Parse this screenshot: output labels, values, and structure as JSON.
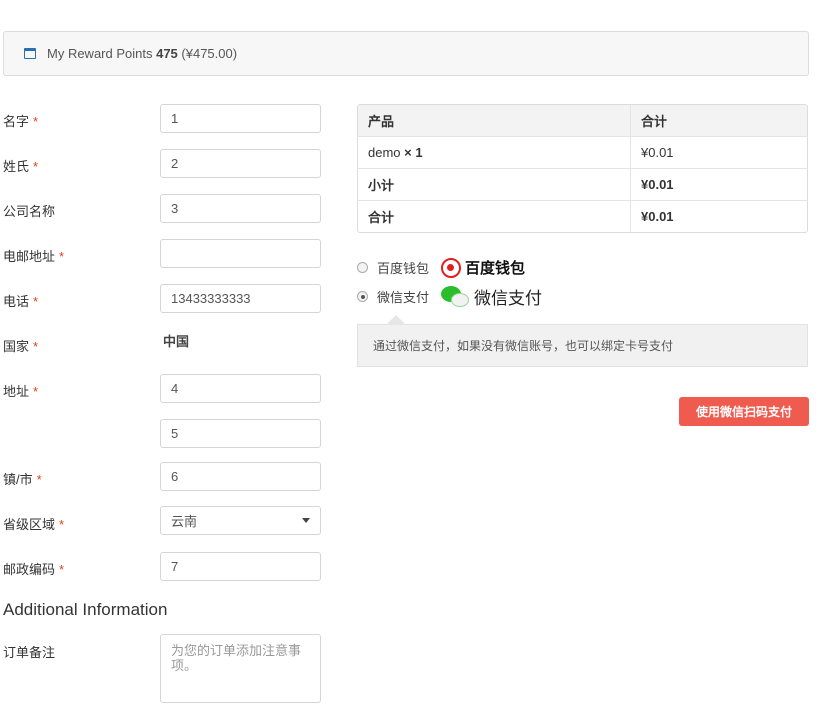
{
  "notice": {
    "prefix": "My Reward Points ",
    "points": "475",
    "suffix": " (¥475.00)"
  },
  "form": {
    "first_name": {
      "label": "名字",
      "required": "*",
      "value": "1"
    },
    "last_name": {
      "label": "姓氏",
      "required": "*",
      "value": "2"
    },
    "company": {
      "label": "公司名称",
      "value": "3"
    },
    "email": {
      "label": "电邮地址",
      "required": "*",
      "value": ""
    },
    "phone": {
      "label": "电话",
      "required": "*",
      "value": "13433333333"
    },
    "country": {
      "label": "国家",
      "required": "*",
      "value": "中国"
    },
    "address": {
      "label": "地址",
      "required": "*",
      "value1": "4",
      "value2": "5"
    },
    "city": {
      "label": "镇/市",
      "required": "*",
      "value": "6"
    },
    "state": {
      "label": "省级区域",
      "required": "*",
      "value": "云南"
    },
    "postcode": {
      "label": "邮政编码",
      "required": "*",
      "value": "7"
    }
  },
  "additional": {
    "title": "Additional Information",
    "notes_label": "订单备注",
    "notes_placeholder": "为您的订单添加注意事项。"
  },
  "order": {
    "headers": [
      "产品",
      "合计"
    ],
    "item_name": "demo ",
    "item_qty": "× 1",
    "item_total": "¥0.01",
    "subtotal_label": "小计",
    "subtotal": "¥0.01",
    "total_label": "合计",
    "total": "¥0.01"
  },
  "payment": {
    "methods": [
      {
        "label": "百度钱包",
        "logo_text": "百度钱包",
        "selected": false
      },
      {
        "label": "微信支付",
        "logo_text": "微信支付",
        "selected": true
      }
    ],
    "description": "通过微信支付，如果没有微信账号，也可以绑定卡号支付",
    "button": "使用微信扫码支付"
  },
  "colors": {
    "required": "#e2401c",
    "button": "#ef5b4f",
    "wechat_green": "#2bbd2b",
    "baidu_red": "#e02020"
  }
}
